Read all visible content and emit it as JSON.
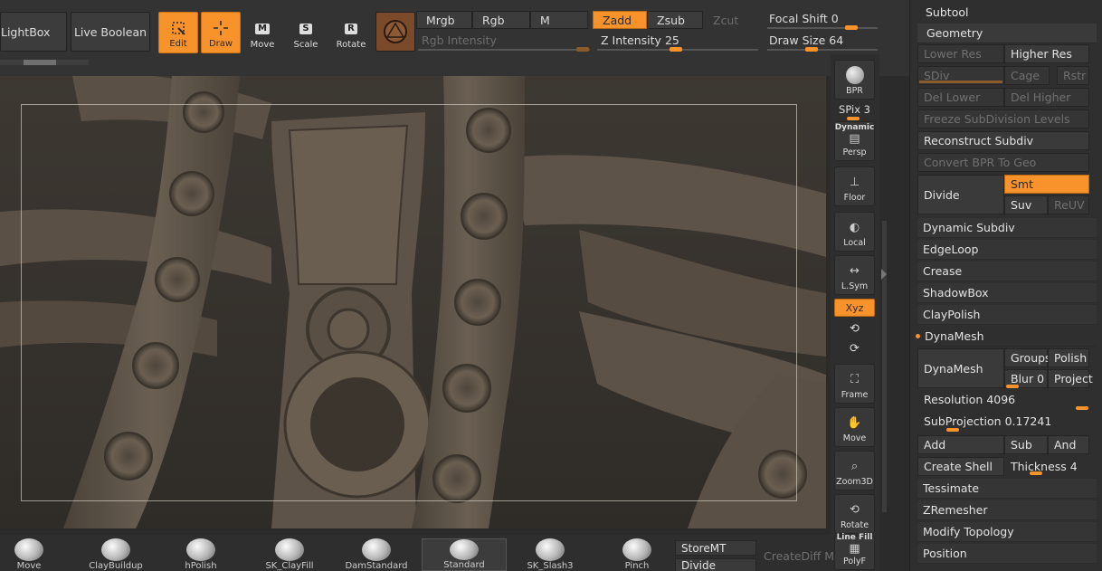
{
  "toolbar": {
    "lightbox": "LightBox",
    "live_boolean": "Live Boolean",
    "edit": "Edit",
    "draw": "Draw",
    "move": "Move",
    "scale": "Scale",
    "rotate": "Rotate",
    "move_key": "M",
    "scale_key": "S",
    "rotate_key": "R",
    "mrgb": "Mrgb",
    "rgb": "Rgb",
    "m": "M",
    "rgb_intensity": "Rgb Intensity",
    "zadd": "Zadd",
    "zsub": "Zsub",
    "zcut": "Zcut",
    "z_intensity_label": "Z Intensity",
    "z_intensity_value": "25",
    "focal_shift_label": "Focal Shift",
    "focal_shift_value": "0",
    "draw_size_label": "Draw Size",
    "draw_size_value": "64"
  },
  "shelf": {
    "bpr": "BPR",
    "spix_label": "SPix",
    "spix_value": "3",
    "dynamic": "Dynamic",
    "persp": "Persp",
    "floor": "Floor",
    "local": "Local",
    "lsym": "L.Sym",
    "xyz": "Xyz",
    "frame": "Frame",
    "move": "Move",
    "zoom3d": "Zoom3D",
    "rotate": "Rotate",
    "line_fill": "Line Fill",
    "polyf": "PolyF"
  },
  "bottom": {
    "storemt": "StoreMT",
    "divide": "Divide",
    "create_diff": "CreateDiff M",
    "brushes": [
      "Move",
      "ClayBuildup",
      "hPolish",
      "SK_ClayFill",
      "DamStandard",
      "Standard",
      "SK_Slash3",
      "Pinch"
    ]
  },
  "panel": {
    "subtool": "Subtool",
    "geometry": "Geometry",
    "lower_res": "Lower Res",
    "higher_res": "Higher Res",
    "sdiv": "SDiv",
    "cage": "Cage",
    "rstr": "Rstr",
    "del_lower": "Del Lower",
    "del_higher": "Del Higher",
    "freeze": "Freeze SubDivision Levels",
    "reconstruct": "Reconstruct Subdiv",
    "convert_bpr": "Convert BPR To Geo",
    "divide": "Divide",
    "smt": "Smt",
    "suv": "Suv",
    "reuv": "ReUV",
    "dynamic_subdiv": "Dynamic Subdiv",
    "edgeloop": "EdgeLoop",
    "crease": "Crease",
    "shadowbox": "ShadowBox",
    "claypolish": "ClayPolish",
    "dynamesh_header": "DynaMesh",
    "dynamesh": "DynaMesh",
    "groups": "Groups",
    "polish": "Polish",
    "blur_label": "Blur",
    "blur_value": "0",
    "project": "Project",
    "resolution_label": "Resolution",
    "resolution_value": "4096",
    "subprojection_label": "SubProjection",
    "subprojection_value": "0.17241",
    "add": "Add",
    "sub": "Sub",
    "and": "And",
    "create_shell": "Create Shell",
    "thickness_label": "Thickness",
    "thickness_value": "4",
    "tessimate": "Tessimate",
    "zremesher": "ZRemesher",
    "modify_topology": "Modify Topology",
    "position": "Position"
  },
  "colors": {
    "accent": "#f7932a",
    "panel": "#2f2f2f",
    "viewport": "#3a3631"
  }
}
